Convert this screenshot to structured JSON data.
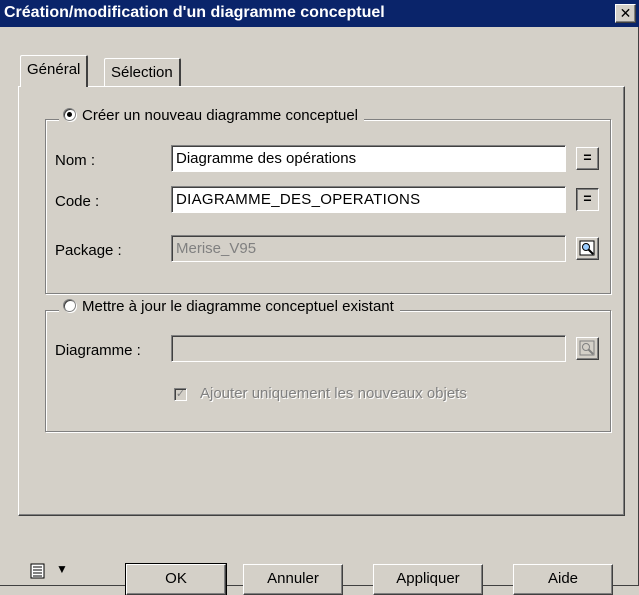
{
  "window": {
    "title": "Création/modification d'un diagramme conceptuel",
    "close_glyph": "✕"
  },
  "tabs": [
    {
      "label": "Général",
      "active": true
    },
    {
      "label": "Sélection",
      "active": false
    }
  ],
  "create_group": {
    "option_label": "Créer un nouveau diagramme conceptuel",
    "selected": true,
    "fields": {
      "nom": {
        "label": "Nom :",
        "value": "Diagramme des opérations",
        "button": "="
      },
      "code": {
        "label": "Code :",
        "value": "DIAGRAMME_DES_OPERATIONS",
        "button": "="
      },
      "package": {
        "label": "Package :",
        "value": "Merise_V95",
        "button_icon": "browse-icon"
      }
    }
  },
  "update_group": {
    "option_label": "Mettre à jour le diagramme conceptuel existant",
    "selected": false,
    "diagram_label": "Diagramme :",
    "diagram_value": "",
    "diagram_button_icon": "browse-icon",
    "checkbox_label": "Ajouter uniquement les nouveaux objets",
    "checkbox_checked": true,
    "checkbox_mark": "✓"
  },
  "footer": {
    "menu_icon": "properties-menu-icon",
    "menu_arrow": "▼",
    "ok": "OK",
    "cancel": "Annuler",
    "apply": "Appliquer",
    "help": "Aide"
  },
  "colors": {
    "titlebar": "#0a246a",
    "face": "#d4d0c8",
    "disabled_text": "#808080"
  }
}
